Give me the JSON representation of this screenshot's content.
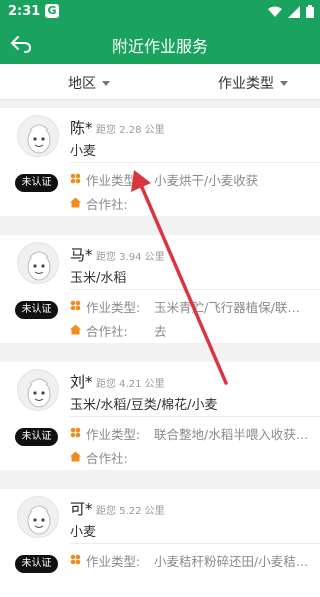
{
  "status_bar": {
    "time": "2:31",
    "app_badge": "G"
  },
  "header": {
    "title": "附近作业服务"
  },
  "filters": {
    "region": "地区",
    "work_type": "作业类型"
  },
  "labels": {
    "uncertified": "未认证",
    "work_type_label": "作业类型:",
    "coop_label": "合作社:"
  },
  "providers": [
    {
      "name": "陈*",
      "distance": "距您 2.28 公里",
      "crops": "小麦",
      "work_types": "小麦烘干/小麦收获",
      "coop": ""
    },
    {
      "name": "马*",
      "distance": "距您 3.94 公里",
      "crops": "玉米/水稻",
      "work_types": "玉米青贮/飞行器植保/联…",
      "coop": "去"
    },
    {
      "name": "刘*",
      "distance": "距您 4.21 公里",
      "crops": "玉米/水稻/豆类/棉花/小麦",
      "work_types": "联合整地/水稻半喂入收获…",
      "coop": ""
    },
    {
      "name": "可*",
      "distance": "距您 5.22 公里",
      "crops": "小麦",
      "work_types": "小麦秸秆粉碎还田/小麦秸…",
      "coop": ""
    }
  ],
  "colors": {
    "brand_green": "#1aa35f",
    "icon_orange": "#f08c1e",
    "arrow_red": "#d9363e"
  }
}
